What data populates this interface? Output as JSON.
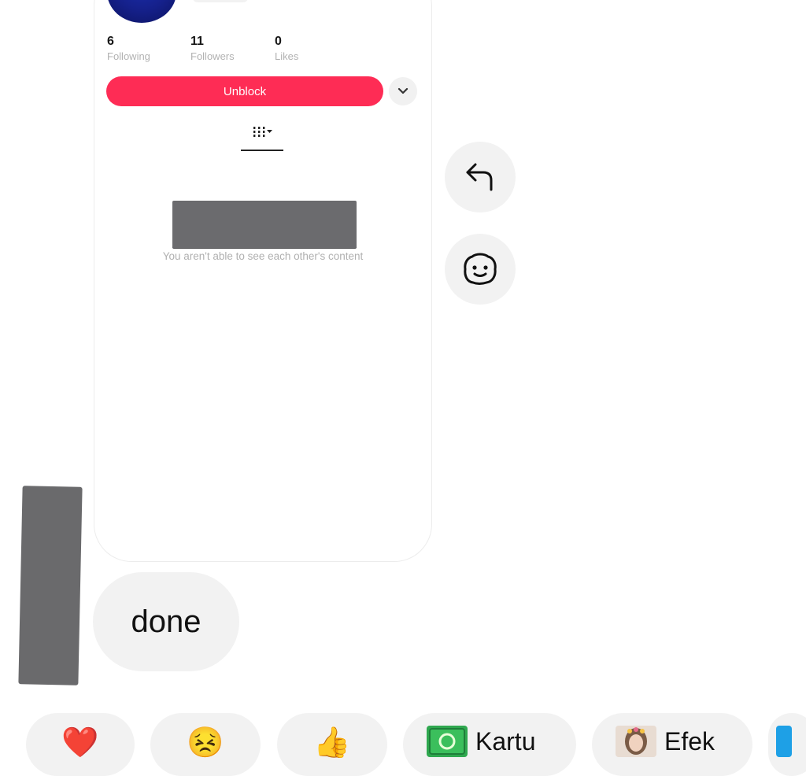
{
  "profile": {
    "stats": [
      {
        "num": "6",
        "label": "Following"
      },
      {
        "num": "11",
        "label": "Followers"
      },
      {
        "num": "0",
        "label": "Likes"
      }
    ],
    "unblock_label": "Unblock",
    "restricted_text": "You aren't able to see each other's content"
  },
  "message": {
    "text": "done"
  },
  "quick_reactions": [
    {
      "emoji": "❤️"
    },
    {
      "emoji": "😣"
    },
    {
      "emoji": "👍"
    },
    {
      "label": "Kartu"
    },
    {
      "label": "Efek"
    }
  ],
  "colors": {
    "accent": "#fe2c55",
    "bubble": "#f2f2f2"
  }
}
